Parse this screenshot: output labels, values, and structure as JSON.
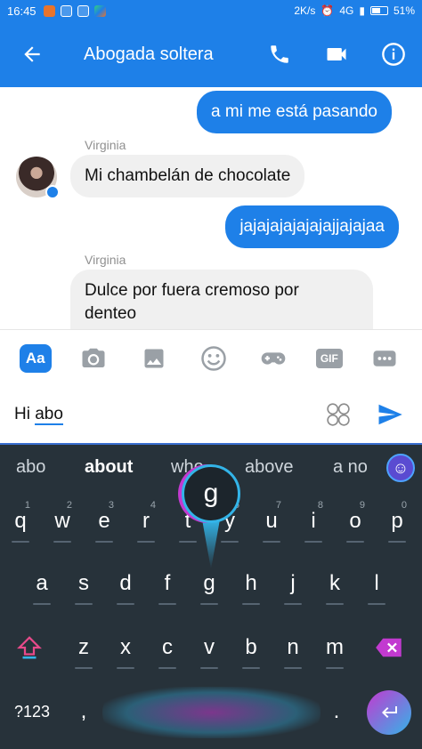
{
  "status_bar": {
    "time": "16:45",
    "speed": "2K/s",
    "network": "4G",
    "battery": "51%"
  },
  "header": {
    "title": "Abogada soltera"
  },
  "messages": [
    {
      "from": "me",
      "text": "a mi me está pasando"
    },
    {
      "from": "Virginia",
      "sender_label": "Virginia",
      "text": "Mi chambelán de chocolate"
    },
    {
      "from": "me",
      "text": "jajajajajajajajjajajaa"
    },
    {
      "from": "Virginia",
      "sender_label": "Virginia",
      "text_line1": "Dulce por fuera cremoso por",
      "text_line2": "denteo"
    }
  ],
  "toolbar": {
    "aa_label": "Aa",
    "gif_label": "GIF",
    "icons": [
      "camera-icon",
      "image-icon",
      "smiley-icon",
      "gamepad-icon",
      "more-icon"
    ]
  },
  "composer": {
    "prefix": "Hi ",
    "current_word": "abo"
  },
  "keyboard": {
    "suggestions": [
      "abo",
      "about",
      "who",
      "above",
      "a no"
    ],
    "row1": [
      {
        "key": "q",
        "hint": "1"
      },
      {
        "key": "w",
        "hint": "2"
      },
      {
        "key": "e",
        "hint": "3"
      },
      {
        "key": "r",
        "hint": "4"
      },
      {
        "key": "t",
        "hint": "5"
      },
      {
        "key": "y",
        "hint": "6"
      },
      {
        "key": "u",
        "hint": "7"
      },
      {
        "key": "i",
        "hint": "8"
      },
      {
        "key": "o",
        "hint": "9"
      },
      {
        "key": "p",
        "hint": "0"
      }
    ],
    "row2": [
      "a",
      "s",
      "d",
      "f",
      "g",
      "h",
      "j",
      "k",
      "l"
    ],
    "row3": [
      "z",
      "x",
      "c",
      "v",
      "b",
      "n",
      "m"
    ],
    "popup_key": "g",
    "symbols_label": "?123",
    "comma": ",",
    "period": "."
  },
  "colors": {
    "brand": "#1e80e8",
    "keyboard_bg": "#27323a",
    "accent_cyan": "#33b4e8",
    "accent_magenta": "#c23ad0"
  }
}
